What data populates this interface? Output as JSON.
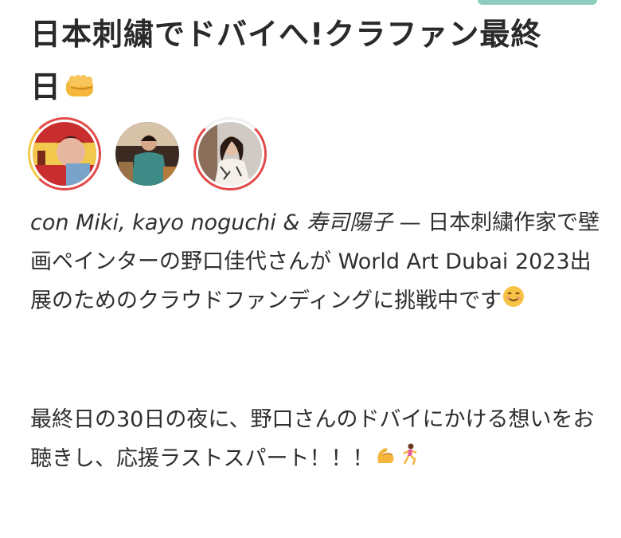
{
  "post": {
    "title": "日本刺繍でドバイへ!クラファン最終日",
    "title_emoji": "fist-icon",
    "with_prefix": "con",
    "with_people": "Miki, kayo noguchi & 寿司陽子",
    "dash": "—",
    "para1": "日本刺繍作家で壁画ペインターの野口佳代さんが World Art Dubai 2023出展のためのクラウドファンディングに挑戦中です",
    "para1_emoji": "smile-icon",
    "para2": "最終日の30日の夜に、野口さんのドバイにかける想いをお聴きし、応援ラストスパート！！！",
    "para2_emojis": [
      "flexed-biceps-icon",
      "running-woman-icon"
    ]
  },
  "colors": {
    "text": "#2f2f2f",
    "accent": "#2fa58a",
    "ring_red": "#e24a4a",
    "ring_yellow": "#f2c94c"
  }
}
